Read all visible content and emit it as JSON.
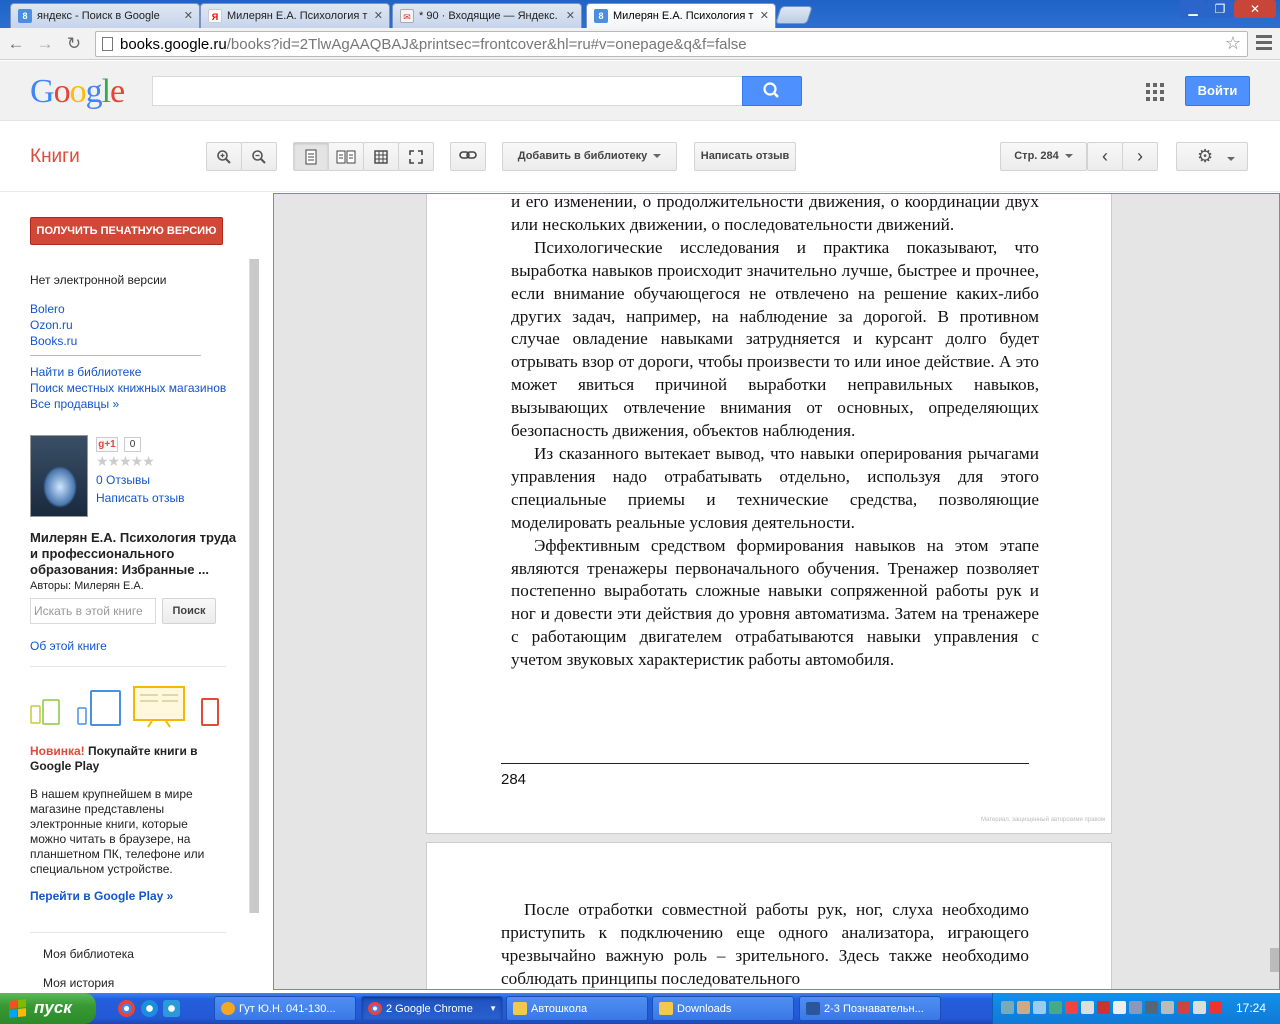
{
  "browser": {
    "tabs": [
      {
        "title": "яндекс - Поиск в Google",
        "favicon": "google-favicon"
      },
      {
        "title": "Милерян Е.А. Психология т",
        "favicon": "yandex-favicon"
      },
      {
        "title": "* 90 · Входящие — Яндекс.",
        "favicon": "mail-favicon"
      },
      {
        "title": "Милерян Е.А. Психология т",
        "favicon": "google-favicon",
        "active": true
      }
    ],
    "url_host": "books.google.ru",
    "url_path": "/books?id=2TlwAgAAQBAJ&printsec=frontcover&hl=ru#v=onepage&q&f=false"
  },
  "header": {
    "logo": "Google",
    "search_placeholder": "",
    "login_label": "Войти"
  },
  "books_bar": {
    "title": "Книги",
    "add_library_label": "Добавить в библиотеку",
    "write_review_label": "Написать отзыв",
    "page_label": "Стр. 284"
  },
  "sidebar": {
    "print_button": "ПОЛУЧИТЬ ПЕЧАТНУЮ ВЕРСИЮ",
    "no_ebook": "Нет электронной версии",
    "sellers": [
      "Bolero",
      "Ozon.ru",
      "Books.ru"
    ],
    "find_links": [
      "Найти в библиотеке",
      "Поиск местных книжных магазинов",
      "Все продавцы »"
    ],
    "gplus_label": "g+1",
    "gplus_count": "0",
    "stars": "★★★★★",
    "reviews_link": "0 Отзывы",
    "write_review_link": "Написать отзыв",
    "book_title": "Милерян Е.А. Психология труда и профессионального образования: Избранные ...",
    "authors": "Авторы: Милерян Е.А.",
    "search_placeholder": "Искать в этой книге",
    "search_button": "Поиск",
    "about_link": "Об этой книге",
    "promo_new": "Новинка!",
    "promo_title": " Покупайте книги в Google Play",
    "promo_body": "В нашем крупнейшем в мире магазине представлены электронные книги, которые можно читать в браузере, на планшетном ПК, телефоне или специальном устройстве.",
    "promo_link": "Перейти в Google Play »",
    "my_library": "Моя библиотека",
    "my_history": "Моя история"
  },
  "viewer": {
    "page1_paragraphs": [
      {
        "indent": false,
        "text": "и его изменении, о продолжительности движения, о координации двух или нескольких движении, о последовательности движений."
      },
      {
        "indent": true,
        "text": "Психологические исследования и практика показывают, что выработка навыков происходит значительно лучше, быстрее и прочнее, если внимание обучающегося не отвлечено на решение каких-либо других задач, например, на наблюдение за дорогой. В противном случае овладение навыками затрудняется и курсант долго будет отрывать взор от дороги, чтобы произвести то или иное действие. А это может явиться причиной выработки неправильных навыков, вызывающих отвлечение внимания от основных, определяющих безопасность движения, объектов наблюдения."
      },
      {
        "indent": true,
        "text": "Из сказанного вытекает вывод, что навыки оперирования рычагами управления надо отрабатывать отдельно, используя для этого специальные приемы и технические средства, позволяющие моделировать реальные условия деятельности."
      },
      {
        "indent": true,
        "text": "Эффективным средством формирования навыков на этом этапе являются тренажеры первоначального обучения. Тренажер позволяет постепенно выработать сложные навыки сопряженной работы рук и ног и довести эти действия до уровня автоматизма. Затем на тренажере с работающим двигателем отрабатываются навыки управления с учетом звуковых характеристик работы автомобиля."
      }
    ],
    "page1_number": "284",
    "watermark": "Материал, защищенный авторскими правом",
    "page2_paragraphs": [
      {
        "indent": true,
        "text": "После отработки совместной работы рук, ног, слуха необходимо приступить к подключению еще одного анализатора, играющего чрезвычайно важную роль – зрительного. Здесь также необходимо соблюдать принципы последовательного"
      }
    ]
  },
  "taskbar": {
    "start_label": "пуск",
    "tasks": [
      {
        "label": "Гут Ю.Н. 041-130...",
        "icon": "smiley-icon"
      },
      {
        "label": "2 Google Chrome",
        "icon": "chrome-icon",
        "active": true
      },
      {
        "label": "Автошкола",
        "icon": "folder-icon"
      },
      {
        "label": "Downloads",
        "icon": "folder-icon"
      },
      {
        "label": "2-3 Познавательн...",
        "icon": "word-icon"
      }
    ],
    "clock": "17:24"
  }
}
